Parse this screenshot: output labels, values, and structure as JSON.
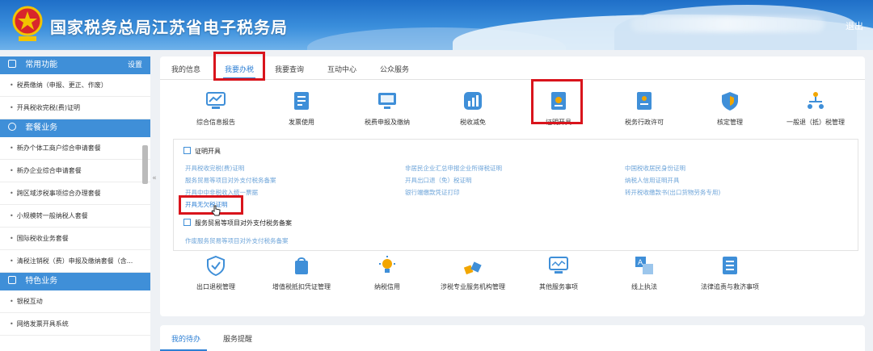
{
  "header": {
    "title": "国家税务总局江苏省电子税务局",
    "logout": "退出"
  },
  "sidebar": {
    "sections": [
      {
        "title": "常用功能",
        "setting": "设置",
        "items": [
          "税费缴纳（申报、更正、作废）",
          "开具税收完税(费)证明"
        ]
      },
      {
        "title": "套餐业务",
        "items": [
          "新办个体工商户综合申请套餐",
          "新办企业综合申请套餐",
          "跨区域涉税事项综合办理套餐",
          "小规模转一般纳税人套餐",
          "国际税收业务套餐",
          "清税注销税（费）申报及缴纳套餐（含..."
        ]
      },
      {
        "title": "特色业务",
        "items": [
          "银税互动",
          "网络发票开具系统"
        ]
      }
    ]
  },
  "tabs": [
    "我的信息",
    "我要办税",
    "我要查询",
    "互动中心",
    "公众服务"
  ],
  "services_top": [
    "综合信息报告",
    "发票使用",
    "税费申报及缴纳",
    "税收减免",
    "证明开具",
    "税务行政许可",
    "核定管理",
    "一般退（抵）税管理"
  ],
  "panel": {
    "section1": "证明开具",
    "col1": [
      "开具税收完税(费)证明",
      "服务贸易等项目对外支付税务备案",
      "开具中中非税收入统一票据",
      "开具无欠税证明"
    ],
    "col2": [
      "非居民企业汇总申报企业所得税证明",
      "开具出口退（免）税证明",
      "银行端缴款凭证打印"
    ],
    "col3": [
      "中国税收居民身份证明",
      "纳税人信用证明开具",
      "转开税收缴款书(出口货物劳务专用)"
    ],
    "section2": "服务贸易等项目对外支付税务备案",
    "sub2": "作废服务贸易等项目对外支付税务备案"
  },
  "services_bottom": [
    "出口退税管理",
    "增值税抵扣凭证管理",
    "纳税信用",
    "涉税专业服务机构管理",
    "其他服务事项",
    "线上执法",
    "法律追责与救济事项"
  ],
  "bottom_tabs": [
    "我的待办",
    "服务提醒"
  ],
  "colors": {
    "accent": "#2d7fd4",
    "highlight": "#d9141c",
    "sidebar_head": "#3f8fd8"
  }
}
